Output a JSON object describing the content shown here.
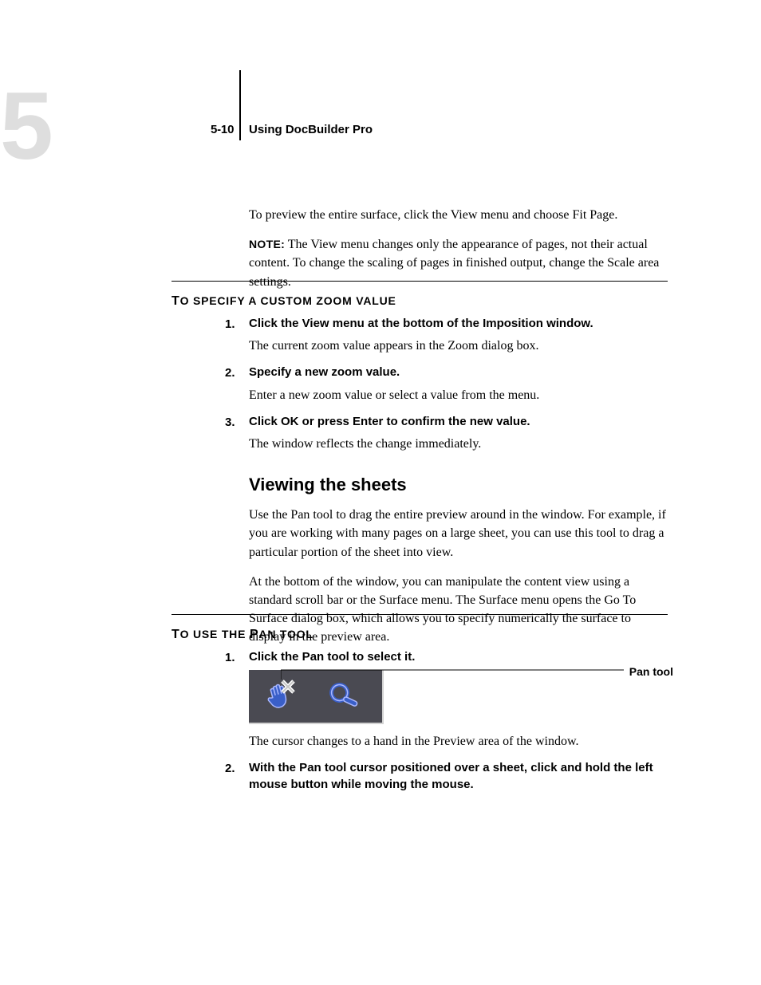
{
  "header": {
    "chapter_glyph": "5",
    "page_number": "5-10",
    "running_head": "Using DocBuilder Pro"
  },
  "intro": {
    "p1": "To preview the entire surface, click the View menu and choose Fit Page.",
    "note_label": "NOTE:",
    "note_body": "The View menu changes only the appearance of pages, not their actual content. To change the scaling of pages in finished output, change the Scale area settings."
  },
  "proc1": {
    "title_lead": "T",
    "title_rest": "O SPECIFY A CUSTOM ZOOM VALUE",
    "steps": [
      {
        "n": "1.",
        "head": "Click the View menu at the bottom of the Imposition window.",
        "body": "The current zoom value appears in the Zoom dialog box."
      },
      {
        "n": "2.",
        "head": "Specify a new zoom value.",
        "body": "Enter a new zoom value or select a value from the menu."
      },
      {
        "n": "3.",
        "head": "Click OK or press Enter to confirm the new value.",
        "body": "The window reflects the change immediately."
      }
    ]
  },
  "section": {
    "title": "Viewing the sheets",
    "p1": "Use the Pan tool to drag the entire preview around in the window. For example, if you are working with many pages on a large sheet, you can use this tool to drag a particular portion of the sheet into view.",
    "p2": "At the bottom of the window, you can manipulate the content view using a standard scroll bar or the Surface menu. The Surface menu opens the Go To Surface dialog box, which allows you to specify numerically the surface to display in the preview area."
  },
  "proc2": {
    "title_lead": "T",
    "title_rest": "O USE THE ",
    "title_lead2": "P",
    "title_rest2": "AN TOOL",
    "callout": "Pan tool",
    "steps": [
      {
        "n": "1.",
        "head": "Click the Pan tool to select it.",
        "body": "The cursor changes to a hand in the Preview area of the window."
      },
      {
        "n": "2.",
        "head": "With the Pan tool cursor positioned over a sheet, click and hold the left mouse button while moving the mouse.",
        "body": ""
      }
    ]
  }
}
